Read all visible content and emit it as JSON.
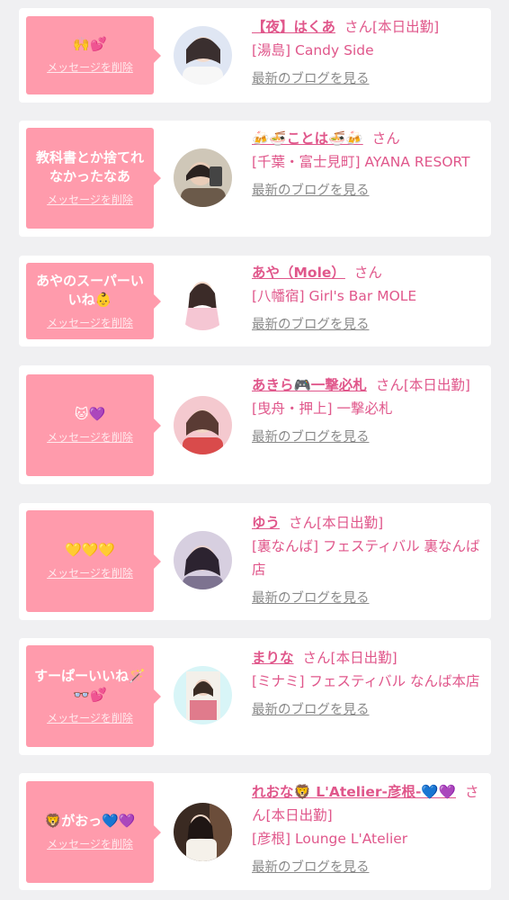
{
  "cards": [
    {
      "message": "🙌💕",
      "delete_label": "メッセージを削除",
      "name": "【夜】はくあ",
      "honorific": "さん",
      "status": "[本日出勤]",
      "shop": "[湯島] Candy Side",
      "blog_label": "最新のブログを見る"
    },
    {
      "message": "教科書とか捨てれなかったなあ",
      "delete_label": "メッセージを削除",
      "name": "🍻🍜ことは🍜🍻",
      "honorific": "さん",
      "status": "",
      "shop": "[千葉・富士見町] AYANA RESORT",
      "blog_label": "最新のブログを見る"
    },
    {
      "message": "あやのスーパーいいね👶",
      "delete_label": "メッセージを削除",
      "name": "あや（Mole）",
      "honorific": "さん",
      "status": "",
      "shop": "[八幡宿] Girl's Bar MOLE",
      "blog_label": "最新のブログを見る"
    },
    {
      "message": "🐱💜",
      "delete_label": "メッセージを削除",
      "name": "あきら🎮一撃必札",
      "honorific": "さん",
      "status": "[本日出勤]",
      "shop": "[曳舟・押上] 一撃必札",
      "blog_label": "最新のブログを見る"
    },
    {
      "message": "💛💛💛",
      "delete_label": "メッセージを削除",
      "name": "ゆう",
      "honorific": "さん",
      "status": "[本日出勤]",
      "shop": "[裏なんば] フェスティバル 裏なんば店",
      "blog_label": "最新のブログを見る"
    },
    {
      "message": "すーぱーいいね🪄👓💕",
      "delete_label": "メッセージを削除",
      "name": "まりな",
      "honorific": "さん",
      "status": "[本日出勤]",
      "shop": "[ミナミ] フェスティバル なんば本店",
      "blog_label": "最新のブログを見る"
    },
    {
      "message": "🦁がおっ💙💜",
      "delete_label": "メッセージを削除",
      "name": "れおな🦁 L'Atelier-彦根-💙💜",
      "honorific": "さん",
      "status": "[本日出勤]",
      "shop": "[彦根] Lounge L'Atelier",
      "blog_label": "最新のブログを見る"
    }
  ],
  "colors": {
    "bubble": "#ff9bac",
    "accent": "#e0578b",
    "muted": "#8a8a8a",
    "background": "#f0f0f2"
  }
}
